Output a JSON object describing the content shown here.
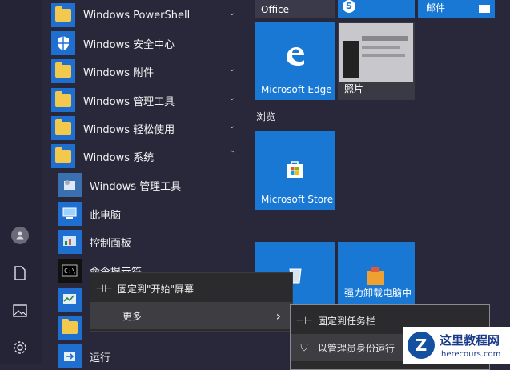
{
  "app_list": [
    {
      "label": "Windows PowerShell",
      "icon": "folder-icon",
      "chevron": "⌄"
    },
    {
      "label": "Windows 安全中心",
      "icon": "shield-icon",
      "chevron": ""
    },
    {
      "label": "Windows 附件",
      "icon": "folder-icon",
      "chevron": "⌄"
    },
    {
      "label": "Windows 管理工具",
      "icon": "folder-icon",
      "chevron": "⌄"
    },
    {
      "label": "Windows 轻松使用",
      "icon": "folder-icon",
      "chevron": "⌄"
    },
    {
      "label": "Windows 系统",
      "icon": "folder-icon",
      "chevron": "⌃"
    }
  ],
  "sub_items": [
    {
      "label": "Windows 管理工具",
      "icon": "admin-tools-icon"
    },
    {
      "label": "此电脑",
      "icon": "computer-icon"
    },
    {
      "label": "控制面板",
      "icon": "control-panel-icon"
    },
    {
      "label": "命令提示符",
      "icon": "command-prompt-icon"
    },
    {
      "label": "",
      "icon": "task-manager-icon"
    },
    {
      "label": "",
      "icon": "file-explorer-icon"
    },
    {
      "label": "运行",
      "icon": "run-icon"
    }
  ],
  "tiles": {
    "office": "Office",
    "mail": "邮件",
    "edge": "Microsoft Edge",
    "photos": "照片",
    "store": "Microsoft Store",
    "strong_uninstall": "强力卸载电脑中"
  },
  "groups": {
    "browse": "浏览"
  },
  "context_menu": {
    "pin_start": "固定到\"开始\"屏幕",
    "more": "更多",
    "more_arrow": "›"
  },
  "submenu": {
    "pin_taskbar": "固定到任务栏",
    "run_as_admin": "以管理员身份运行"
  },
  "watermark": {
    "title": "这里教程网",
    "url": "herecours.com",
    "logo_letter": "Z"
  },
  "colors": {
    "tile_blue": "#1878d4",
    "folder_yellow": "#f2c94c",
    "bg": "#28283a"
  }
}
